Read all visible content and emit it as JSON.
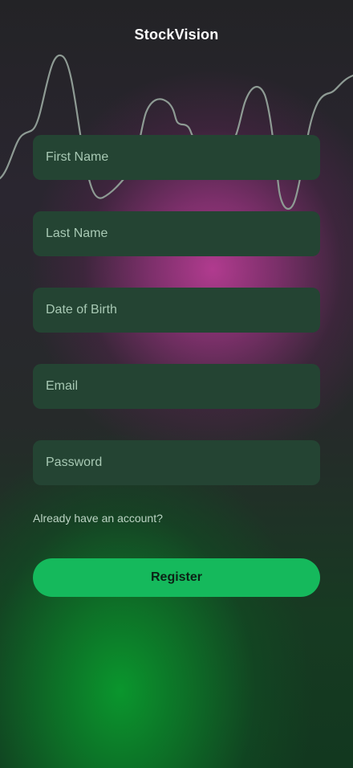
{
  "app": {
    "title": "StockVision"
  },
  "form": {
    "first_name_placeholder": "First Name",
    "last_name_placeholder": "Last Name",
    "dob_placeholder": "Date of Birth",
    "email_placeholder": "Email",
    "password_placeholder": "Password",
    "login_link": "Already have an account?",
    "register_label": "Register"
  },
  "colors": {
    "accent_green": "#15b95c",
    "field_bg": "#244433",
    "glow_magenta": "#b83c94",
    "glow_green": "#0a962d"
  }
}
